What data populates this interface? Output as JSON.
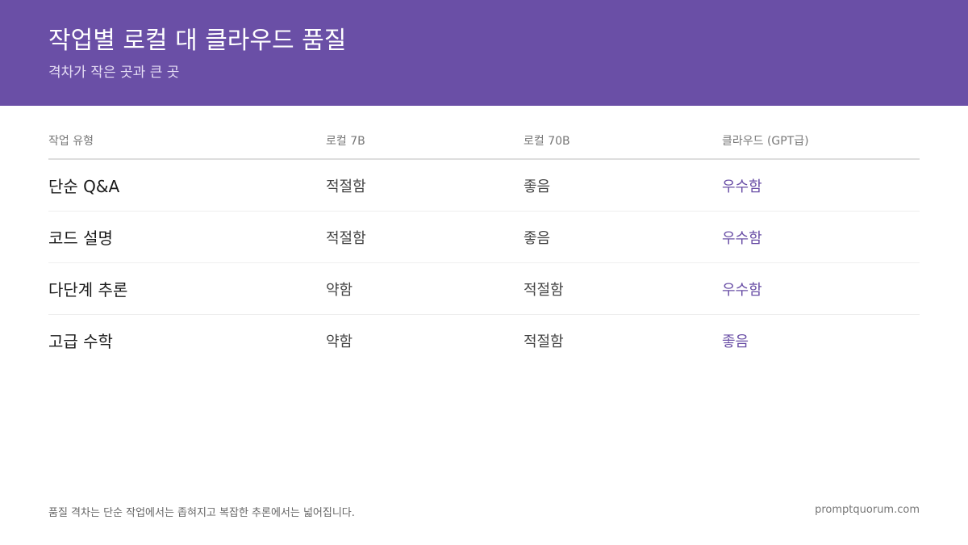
{
  "header": {
    "title": "작업별 로컬 대 클라우드 품질",
    "subtitle": "격차가 작은 곳과 큰 곳"
  },
  "colors": {
    "accent": "#6a4fa6"
  },
  "table": {
    "columns": [
      "작업 유형",
      "로컬 7B",
      "로컬 70B",
      "클라우드 (GPT급)"
    ],
    "rows": [
      [
        "단순 Q&A",
        "적절함",
        "좋음",
        "우수함"
      ],
      [
        "코드 설명",
        "적절함",
        "좋음",
        "우수함"
      ],
      [
        "다단계 추론",
        "약함",
        "적절함",
        "우수함"
      ],
      [
        "고급 수학",
        "약함",
        "적절함",
        "좋음"
      ]
    ]
  },
  "footer": {
    "note": "품질 격차는 단순 작업에서는 좁혀지고 복잡한 추론에서는 넓어집니다.",
    "brand": "promptquorum.com"
  }
}
